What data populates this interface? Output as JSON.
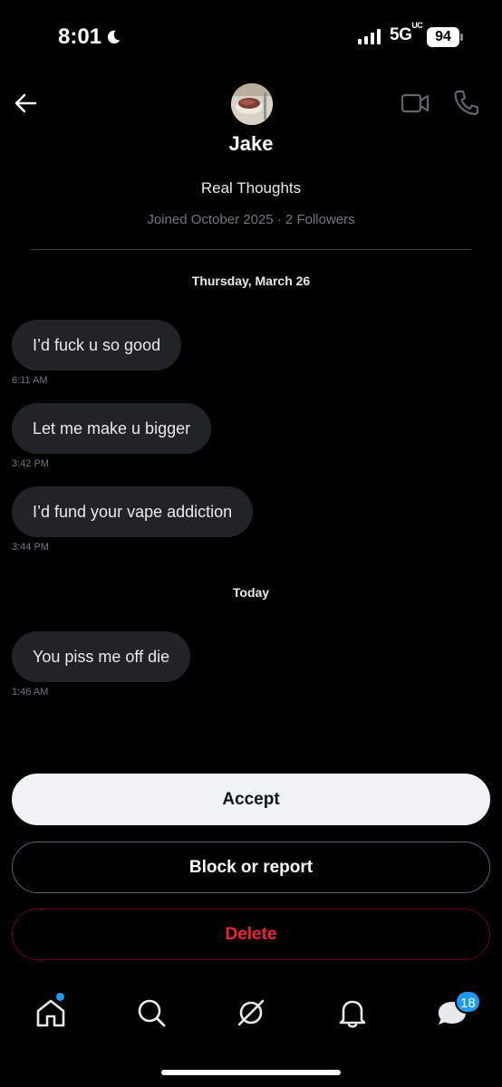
{
  "status_bar": {
    "time": "8:01",
    "network": "5G",
    "network_suffix": "UC",
    "battery": "94"
  },
  "profile": {
    "name": "Jake",
    "bio": "Real Thoughts",
    "meta": "Joined October 2025 · 2 Followers"
  },
  "conversation": {
    "day_1": "Thursday, March 26",
    "day_2": "Today",
    "messages": [
      {
        "text": "I’d fuck u so good",
        "time": "6:11 AM"
      },
      {
        "text": "Let me make u bigger",
        "time": "3:42 PM"
      },
      {
        "text": "I’d fund your vape addiction",
        "time": "3:44 PM"
      },
      {
        "text": "You piss me off die",
        "time": "1:46 AM"
      }
    ]
  },
  "actions": {
    "accept": "Accept",
    "block": "Block or report",
    "delete": "Delete"
  },
  "nav": {
    "messages_badge": "18",
    "icons": [
      "home-icon",
      "search-icon",
      "grok-icon",
      "bell-icon",
      "messages-icon"
    ]
  },
  "colors": {
    "accent": "#1d9bf0",
    "danger": "#f4212e",
    "bubble": "#202327"
  }
}
